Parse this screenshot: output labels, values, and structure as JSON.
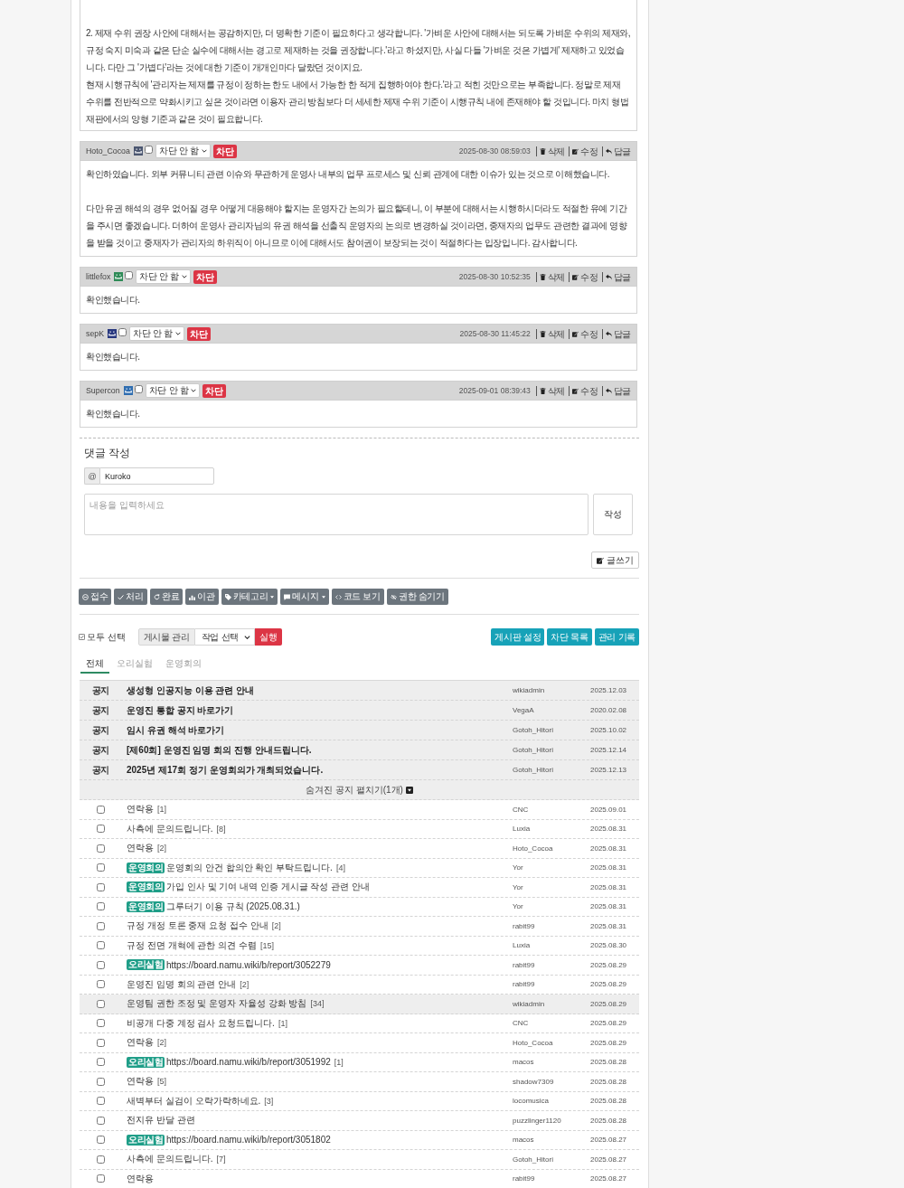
{
  "top_comment": {
    "body": "2. 제재 수위 권장 사안에 대해서는 공감하지만, 더 명확한 기준이 필요하다고 생각합니다. '가벼운 사안에 대해서는 되도록 가벼운 수위의 제재와, 규정 숙지 미숙과 같은 단순 실수에 대해서는 경고로 제재하는 것을 권장합니다.'라고 하셨지만, 사실 다들 '가벼운 것은 가볍게' 제재하고 있었습니다. 다만 그 '가볍다'라는 것에 대한 기준이 개개인마다 달랐던 것이지요.\n현재 시행규칙에 '관리자는 제재를 규정이 정하는 한도 내에서 가능한 한 적게 집행하여야 한다.'라고 적힌 것만으로는 부족합니다. 정말로 제재 수위를 전반적으로 약화시키고 싶은 것이라면 이용자 관리 방침보다 더 세세한 제재 수위 기준이 시행규칙 내에 존재해야 할 것입니다. 마치 형법 재판에서의 양형 기준과 같은 것이 필요합니다."
  },
  "comments": [
    {
      "author": "Hoto_Cocoa",
      "color": "#4b5670",
      "checked": false,
      "block_select": "차단 안 함",
      "block_button": "차단",
      "date": "2025-08-30 08:59:03",
      "actions": [
        "삭제",
        "수정",
        "답글"
      ],
      "body": "확인하였습니다. 외부 커뮤니티 관련 이슈와 무관하게 운영사 내부의 업무 프로세스 및 신뢰 관계에 대한 이슈가 있는 것으로 이해했습니다.\n\n다만 유권 해석의 경우 없어질 경우 어떻게 대응해야 할지는 운영자간 논의가 필요할테니, 이 부분에 대해서는 시행하시더라도 적절한 유예 기간을 주시면 좋겠습니다. 더하여 운영사 관리자님의 유권 해석을 선출직 운영자의 논의로 변경하실 것이라면, 중재자의 업무도 관련한 결과에 영향을 받을 것이고 중재자가 관리자의 하위직이 아니므로 이에 대해서도 참여권이 보장되는 것이 적절하다는 입장입니다. 감사합니다."
    },
    {
      "author": "littlefox",
      "color": "#2e8b57",
      "checked": false,
      "block_select": "차단 안 함",
      "block_button": "차단",
      "date": "2025-08-30 10:52:35",
      "actions": [
        "삭제",
        "수정",
        "답글"
      ],
      "body": "확인했습니다."
    },
    {
      "author": "sepK",
      "color": "#27377e",
      "checked": false,
      "block_select": "차단 안 함",
      "block_button": "차단",
      "date": "2025-08-30 11:45:22",
      "actions": [
        "삭제",
        "수정",
        "답글"
      ],
      "body": "확인했습니다."
    },
    {
      "author": "Supercon",
      "color": "#2f6db0",
      "checked": false,
      "block_select": "차단 안 함",
      "block_button": "차단",
      "date": "2025-09-01 08:39:43",
      "actions": [
        "삭제",
        "수정",
        "답글"
      ],
      "body": "확인했습니다."
    }
  ],
  "comment_form": {
    "title": "댓글 작성",
    "prefix": "@",
    "name": "Kuroko",
    "placeholder": "내용을 입력하세요",
    "submit": "작성"
  },
  "write_button": "글쓰기",
  "toolbar": [
    {
      "label": "접수",
      "dropdown": false
    },
    {
      "label": "처리",
      "dropdown": false
    },
    {
      "label": "완료",
      "dropdown": false
    },
    {
      "label": "이관",
      "dropdown": false
    },
    {
      "label": "카테고리",
      "dropdown": true
    },
    {
      "label": "메시지",
      "dropdown": true
    },
    {
      "label": "코드 보기",
      "dropdown": false
    },
    {
      "label": "권한 숨기기",
      "dropdown": false
    }
  ],
  "bulk": {
    "select_all": "모두 선택",
    "group_label": "게시물 관리",
    "action_select": "작업 선택",
    "run": "실행"
  },
  "admin_buttons": [
    "게시판 설정",
    "차단 목록",
    "관리 기록"
  ],
  "tabs": [
    {
      "label": "전체",
      "selected": true
    },
    {
      "label": "오리실험",
      "selected": false
    },
    {
      "label": "운영회의",
      "selected": false
    }
  ],
  "notices": [
    {
      "label": "공지",
      "title": "생성형 인공지능 이용 관련 안내",
      "author": "wikiadmin",
      "date": "2025.12.03"
    },
    {
      "label": "공지",
      "title": "운영진 통합 공지 바로가기",
      "author": "VegaA",
      "date": "2020.02.08"
    },
    {
      "label": "공지",
      "title": "임시 유권 해석 바로가기",
      "author": "Gotoh_Hitori",
      "date": "2025.10.02"
    },
    {
      "label": "공지",
      "title": "[제60회] 운영진 임명 회의 진행 안내드립니다.",
      "author": "Gotoh_Hitori",
      "date": "2025.12.14"
    },
    {
      "label": "공지",
      "title": "2025년 제17회 정기 운영회의가 개최되었습니다.",
      "author": "Gotoh_Hitori",
      "date": "2025.12.13"
    }
  ],
  "hidden_notices": "숨겨진 공지 펼치기(1개)",
  "posts": [
    {
      "checked": false,
      "highlighted": false,
      "title": "연락용",
      "comment_count": "[1]",
      "author": "CNC",
      "date": "2025.09.01"
    },
    {
      "checked": false,
      "highlighted": false,
      "title": "사측에 문의드립니다.",
      "comment_count": "[8]",
      "author": "Luxia",
      "date": "2025.08.31"
    },
    {
      "checked": false,
      "highlighted": false,
      "title": "연락용",
      "comment_count": "[2]",
      "author": "Hoto_Cocoa",
      "date": "2025.08.31"
    },
    {
      "checked": false,
      "highlighted": false,
      "category": "운영회의",
      "title": "운영회의 안건 합의안 확인 부탁드립니다.",
      "comment_count": "[4]",
      "author": "Yor",
      "date": "2025.08.31"
    },
    {
      "checked": false,
      "highlighted": false,
      "category": "운영회의",
      "title": "가입 인사 및 기여 내역 인증 게시글 작성 관련 안내",
      "author": "Yor",
      "date": "2025.08.31"
    },
    {
      "checked": false,
      "highlighted": false,
      "category": "운영회의",
      "title": "그루터기 이용 규칙 (2025.08.31.)",
      "author": "Yor",
      "date": "2025.08.31"
    },
    {
      "checked": false,
      "highlighted": false,
      "title": "규정 개정 토론 중재 요청 접수 안내",
      "comment_count": "[2]",
      "author": "rabit99",
      "date": "2025.08.31"
    },
    {
      "checked": false,
      "highlighted": false,
      "title": "규정 전면 개혁에 관한 의견 수렴",
      "comment_count": "[15]",
      "author": "Luxia",
      "date": "2025.08.30"
    },
    {
      "checked": false,
      "highlighted": false,
      "category": "오리실험",
      "title": "https://board.namu.wiki/b/report/3052279",
      "author": "rabit99",
      "date": "2025.08.29"
    },
    {
      "checked": false,
      "highlighted": false,
      "title": "운영진 임명 회의 관련 안내",
      "comment_count": "[2]",
      "author": "rabit99",
      "date": "2025.08.29"
    },
    {
      "checked": false,
      "highlighted": true,
      "title": "운영팀 권한 조정 및 운영자 자율성 강화 방침",
      "comment_count": "[34]",
      "author": "wikiadmin",
      "date": "2025.08.29"
    },
    {
      "checked": false,
      "highlighted": false,
      "title": "비공개 다중 계정 검사 요청드립니다.",
      "comment_count": "[1]",
      "author": "CNC",
      "date": "2025.08.29"
    },
    {
      "checked": false,
      "highlighted": false,
      "title": "연락용",
      "comment_count": "[2]",
      "author": "Hoto_Cocoa",
      "date": "2025.08.29"
    },
    {
      "checked": false,
      "highlighted": false,
      "category": "오리실험",
      "title": "https://board.namu.wiki/b/report/3051992",
      "comment_count": "[1]",
      "author": "macos",
      "date": "2025.08.28"
    },
    {
      "checked": false,
      "highlighted": false,
      "title": "연락용",
      "comment_count": "[5]",
      "author": "shadow7309",
      "date": "2025.08.28"
    },
    {
      "checked": false,
      "highlighted": false,
      "title": "새벽부터 실검이 오락가락하네요.",
      "comment_count": "[3]",
      "author": "locomusica",
      "date": "2025.08.28"
    },
    {
      "checked": false,
      "highlighted": false,
      "title": "전지유 반달 관련",
      "author": "puzzlinger1120",
      "date": "2025.08.28"
    },
    {
      "checked": false,
      "highlighted": false,
      "category": "오리실험",
      "title": "https://board.namu.wiki/b/report/3051802",
      "author": "macos",
      "date": "2025.08.27"
    },
    {
      "checked": false,
      "highlighted": false,
      "title": "사측에 문의드립니다.",
      "comment_count": "[7]",
      "author": "Gotoh_Hitori",
      "date": "2025.08.27"
    },
    {
      "checked": false,
      "highlighted": false,
      "title": "연락용",
      "author": "rabit99",
      "date": "2025.08.27"
    }
  ]
}
